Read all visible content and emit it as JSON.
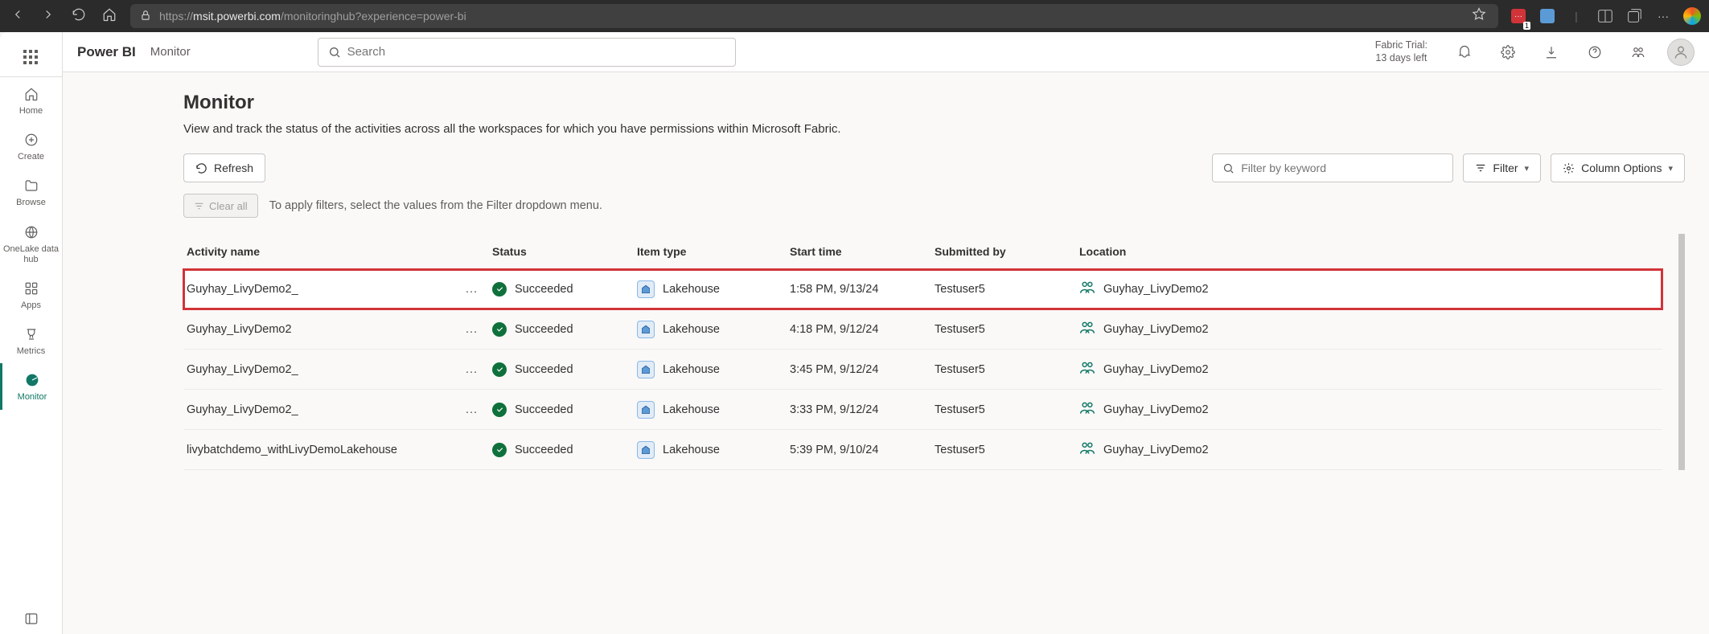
{
  "browser": {
    "url_prefix": "https://",
    "url_domain": "msit.powerbi.com",
    "url_path": "/monitoringhub?experience=power-bi"
  },
  "header": {
    "brand": "Power BI",
    "crumb": "Monitor",
    "search_placeholder": "Search",
    "trial_line1": "Fabric Trial:",
    "trial_line2": "13 days left"
  },
  "leftRail": {
    "items": [
      {
        "label": "Home",
        "icon": "home"
      },
      {
        "label": "Create",
        "icon": "plus-circle"
      },
      {
        "label": "Browse",
        "icon": "folder"
      },
      {
        "label": "OneLake data hub",
        "icon": "globe"
      },
      {
        "label": "Apps",
        "icon": "apps"
      },
      {
        "label": "Metrics",
        "icon": "trophy"
      },
      {
        "label": "Monitor",
        "icon": "radar",
        "active": true
      }
    ]
  },
  "page": {
    "title": "Monitor",
    "description": "View and track the status of the activities across all the workspaces for which you have permissions within Microsoft Fabric.",
    "refresh": "Refresh",
    "filter_kw_placeholder": "Filter by keyword",
    "filter": "Filter",
    "column_options": "Column Options",
    "clear_all": "Clear all",
    "clear_hint": "To apply filters, select the values from the Filter dropdown menu."
  },
  "table": {
    "columns": [
      "Activity name",
      "Status",
      "Item type",
      "Start time",
      "Submitted by",
      "Location"
    ],
    "rows": [
      {
        "activity": "Guyhay_LivyDemo2_",
        "status": "Succeeded",
        "item": "Lakehouse",
        "start": "1:58 PM, 9/13/24",
        "by": "Testuser5",
        "loc": "Guyhay_LivyDemo2",
        "highlight": true,
        "show_ellipsis": true
      },
      {
        "activity": "Guyhay_LivyDemo2",
        "status": "Succeeded",
        "item": "Lakehouse",
        "start": "4:18 PM, 9/12/24",
        "by": "Testuser5",
        "loc": "Guyhay_LivyDemo2",
        "show_ellipsis": true
      },
      {
        "activity": "Guyhay_LivyDemo2_",
        "status": "Succeeded",
        "item": "Lakehouse",
        "start": "3:45 PM, 9/12/24",
        "by": "Testuser5",
        "loc": "Guyhay_LivyDemo2",
        "show_ellipsis": true
      },
      {
        "activity": "Guyhay_LivyDemo2_",
        "status": "Succeeded",
        "item": "Lakehouse",
        "start": "3:33 PM, 9/12/24",
        "by": "Testuser5",
        "loc": "Guyhay_LivyDemo2",
        "show_ellipsis": true
      },
      {
        "activity": "livybatchdemo_withLivyDemoLakehouse",
        "status": "Succeeded",
        "item": "Lakehouse",
        "start": "5:39 PM, 9/10/24",
        "by": "Testuser5",
        "loc": "Guyhay_LivyDemo2",
        "show_ellipsis": false
      }
    ]
  }
}
